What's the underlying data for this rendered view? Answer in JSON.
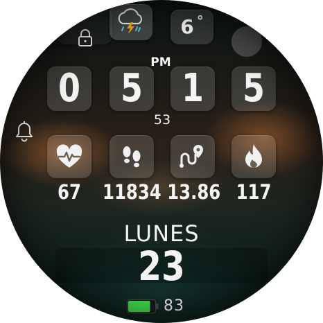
{
  "time": {
    "ampm": "PM",
    "digits": [
      "0",
      "5",
      "1",
      "5"
    ],
    "seconds": "53"
  },
  "weather": {
    "icon": "thunderstorm-cloud-icon",
    "temperature": "6",
    "unit": "°"
  },
  "metrics": [
    {
      "icon": "heart-rate-icon",
      "value": "67"
    },
    {
      "icon": "footsteps-icon",
      "value": "11834"
    },
    {
      "icon": "distance-route-icon",
      "value": "13.86"
    },
    {
      "icon": "calories-flame-icon",
      "value": "117"
    }
  ],
  "date": {
    "day_name": "LUNES",
    "day_number": "23"
  },
  "battery": {
    "level_percent": 83,
    "label": "83",
    "color": "#3ee24a"
  },
  "colors": {
    "text": "#f4f4f4",
    "lightning": "#f5a623",
    "weather_accent": "#58c7f3"
  }
}
